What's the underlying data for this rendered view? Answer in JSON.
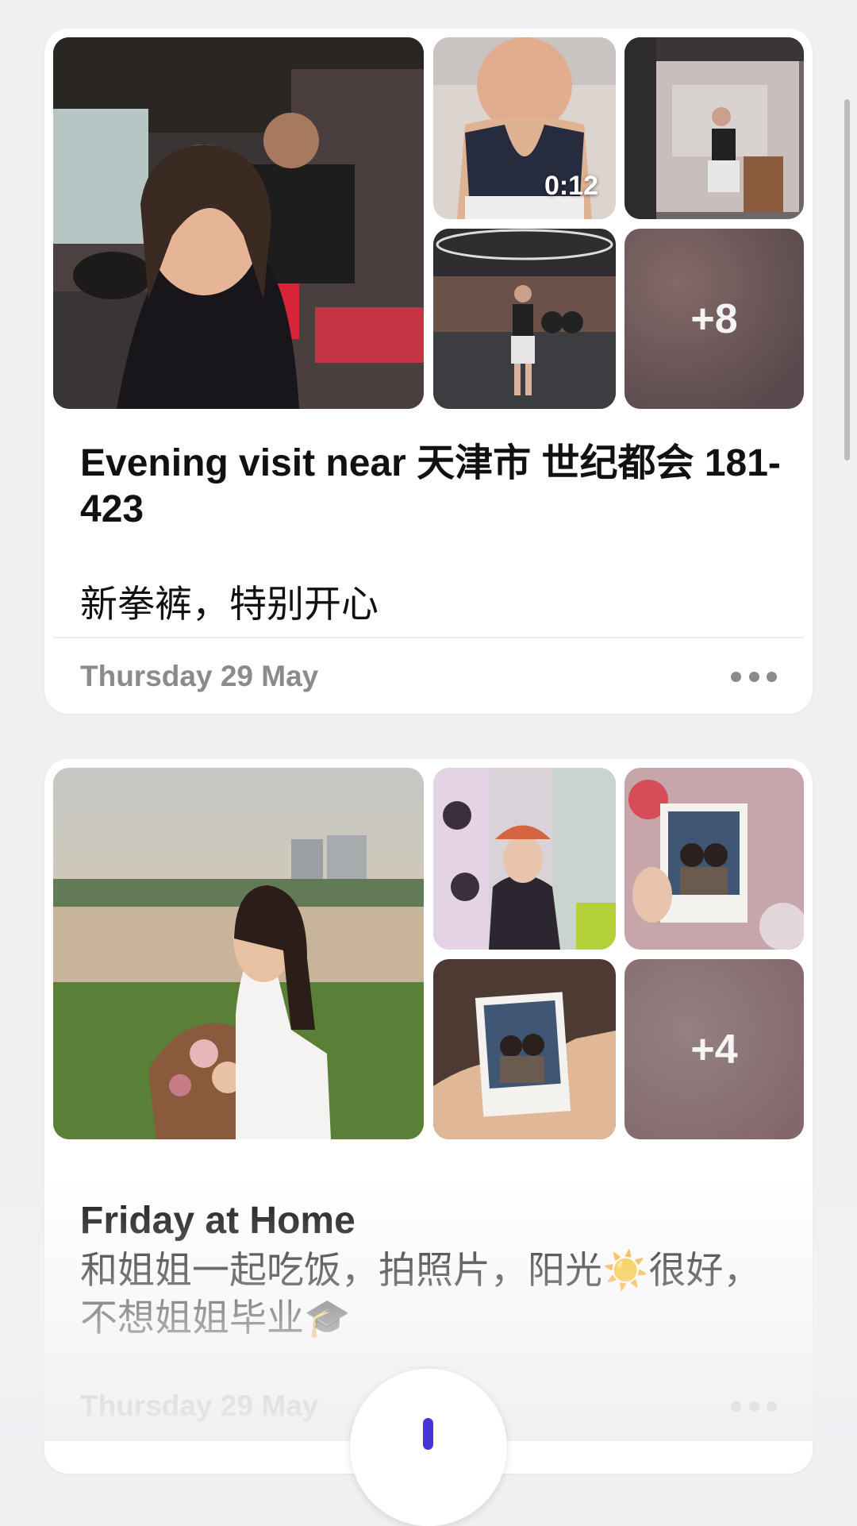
{
  "cards": [
    {
      "title": "Evening visit near 天津市 世纪都会 181-423",
      "description": "新拳裤，特别开心",
      "date": "Thursday 29 May",
      "video_duration": "0:12",
      "more_count": "+8",
      "photos": [
        "boxing-gym-selfie",
        "workout-video",
        "gym-mirror-photo",
        "gym-floor-photo",
        "more-photos"
      ]
    },
    {
      "title": "Friday at Home",
      "description": "和姐姐一起吃饭，拍照片，阳光☀️很好，不想姐姐毕业🎓",
      "date": "Thursday 29 May",
      "more_count": "+4",
      "photos": [
        "lakeside-flowers-portrait",
        "hello-kitty-shop-photo",
        "instant-photo-held",
        "instant-photo-hand",
        "more-photos"
      ]
    }
  ],
  "icons": [
    "more-icon",
    "journal-add-icon"
  ],
  "colors": {
    "accent": "#4536d8",
    "background": "#f1eff1",
    "secondary_text": "#8b8b8d"
  }
}
